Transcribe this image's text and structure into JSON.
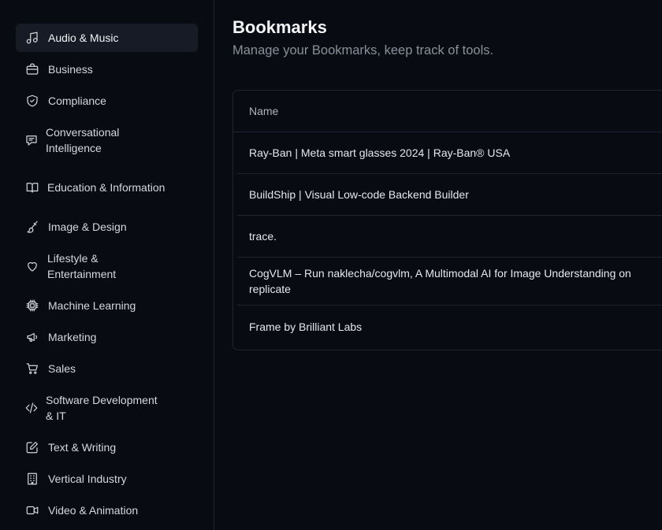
{
  "sidebar": {
    "items": [
      {
        "label": "Audio & Music",
        "icon": "music-icon",
        "active": true
      },
      {
        "label": "Business",
        "icon": "briefcase-icon"
      },
      {
        "label": "Compliance",
        "icon": "shield-check-icon"
      },
      {
        "label": "Conversational Intelligence",
        "icon": "chat-bubble-icon"
      },
      {
        "label": "Education & Information",
        "icon": "open-book-icon"
      },
      {
        "label": "Image & Design",
        "icon": "brush-icon"
      },
      {
        "label": "Lifestyle & Entertainment",
        "icon": "heart-icon"
      },
      {
        "label": "Machine Learning",
        "icon": "cpu-icon"
      },
      {
        "label": "Marketing",
        "icon": "megaphone-icon"
      },
      {
        "label": "Sales",
        "icon": "shopping-cart-icon"
      },
      {
        "label": "Software Development & IT",
        "icon": "code-icon"
      },
      {
        "label": "Text & Writing",
        "icon": "pencil-square-icon"
      },
      {
        "label": "Vertical Industry",
        "icon": "building-icon"
      },
      {
        "label": "Video & Animation",
        "icon": "video-camera-icon"
      }
    ]
  },
  "main": {
    "title": "Bookmarks",
    "subtitle": "Manage your Bookmarks, keep track of tools.",
    "table": {
      "header": "Name",
      "rows": [
        "Ray-Ban | Meta smart glasses 2024 | Ray-Ban® USA",
        "BuildShip | Visual Low-code Backend Builder",
        "trace.",
        "CogVLM – Run naklecha/cogvlm, A Multimodal AI for Image Understanding on replicate",
        "Frame by Brilliant Labs"
      ]
    }
  }
}
